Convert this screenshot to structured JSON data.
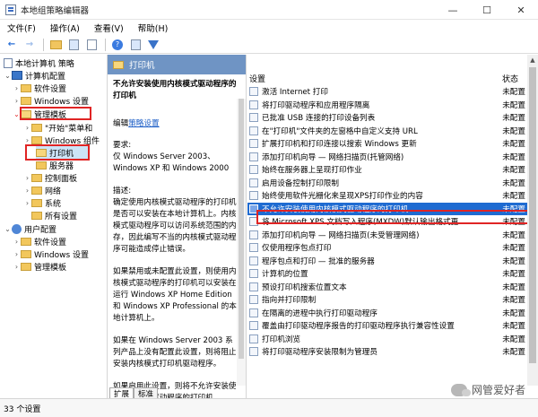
{
  "window": {
    "title": "本地组策略编辑器",
    "minimize": "—",
    "maximize": "☐",
    "close": "✕"
  },
  "menu": [
    "文件(F)",
    "操作(A)",
    "查看(V)",
    "帮助(H)"
  ],
  "tree": {
    "root": "本地计算机 策略",
    "computer_config": "计算机配置",
    "software_settings": "软件设置",
    "windows_settings": "Windows 设置",
    "admin_templates": "管理模板",
    "start_menu": "\"开始\"菜单和",
    "windows_components": "Windows 组件",
    "printers": "打印机",
    "server": "服务器",
    "control_panel": "控制面板",
    "network": "网络",
    "system": "系统",
    "all_settings": "所有设置",
    "user_config": "用户配置",
    "u_software_settings": "软件设置",
    "u_windows_settings": "Windows 设置",
    "u_admin_templates": "管理模板"
  },
  "description": {
    "header": "打印机",
    "title": "不允许安装使用内核模式驱动程序的打印机",
    "edit_prefix": "编辑",
    "edit_link": "策略设置",
    "req_label": "要求:",
    "req_text": "仅 Windows Server 2003、Windows XP 和 Windows 2000",
    "desc_label": "描述:",
    "desc_1": "确定使用内核模式驱动程序的打印机是否可以安装在本地计算机上。内核模式驱动程序可以访问系统范围的内存，因此编写不当的内核模式驱动程序可能造成停止错误。",
    "desc_2": "如果禁用或未配置此设置，则使用内核模式驱动程序的打印机可以安装在运行 Windows XP Home Edition 和 Windows XP Professional 的本地计算机上。",
    "desc_3": "如果在 Windows Server 2003 系列产品上没有配置此设置，则将阻止安装内核模式打印机驱动程序。",
    "desc_4": "如果启用此设置，则将不允许安装使用内核模式驱动程序的打印机。"
  },
  "tabs": {
    "extended": "扩展",
    "standard": "标准"
  },
  "list": {
    "col_setting": "设置",
    "col_status": "状态",
    "rows": [
      {
        "name": "激活 Internet 打印",
        "status": "未配置"
      },
      {
        "name": "将打印驱动程序和应用程序隔离",
        "status": "未配置"
      },
      {
        "name": "已批准 USB 连接的打印设备列表",
        "status": "未配置"
      },
      {
        "name": "在\"打印机\"文件夹的左窗格中自定义支持 URL",
        "status": "未配置"
      },
      {
        "name": "扩展打印机和打印连接以搜索 Windows 更新",
        "status": "未配置"
      },
      {
        "name": "添加打印机向导 — 网络扫描页(托管网络)",
        "status": "未配置"
      },
      {
        "name": "始终在服务器上呈现打印作业",
        "status": "未配置"
      },
      {
        "name": "启用设备控制打印限制",
        "status": "未配置"
      },
      {
        "name": "始终使用软件光栅化来呈现XPS打印作业的内容",
        "status": "未配置"
      },
      {
        "name": "不允许安装使用内核模式驱动程序的打印机",
        "status": "未配置"
      },
      {
        "name": "将 Microsoft XPS 文档写入程序(MXDW)默认输出格式更...",
        "status": "未配置"
      },
      {
        "name": "添加打印机向导 — 网络扫描页(未受管理网络)",
        "status": "未配置"
      },
      {
        "name": "仅使用程序包点打印",
        "status": "未配置"
      },
      {
        "name": "程序包点和打印 — 批准的服务器",
        "status": "未配置"
      },
      {
        "name": "计算机的位置",
        "status": "未配置"
      },
      {
        "name": "预设打印机搜索位置文本",
        "status": "未配置"
      },
      {
        "name": "指向并打印限制",
        "status": "未配置"
      },
      {
        "name": "在隔离的进程中执行打印驱动程序",
        "status": "未配置"
      },
      {
        "name": "覆盖由打印驱动程序报告的打印驱动程序执行兼容性设置",
        "status": "未配置"
      },
      {
        "name": "打印机浏览",
        "status": "未配置"
      },
      {
        "name": "将打印驱动程序安装限制为管理员",
        "status": "未配置"
      }
    ]
  },
  "status": {
    "count": "33 个设置"
  },
  "watermark": "网管爱好者"
}
